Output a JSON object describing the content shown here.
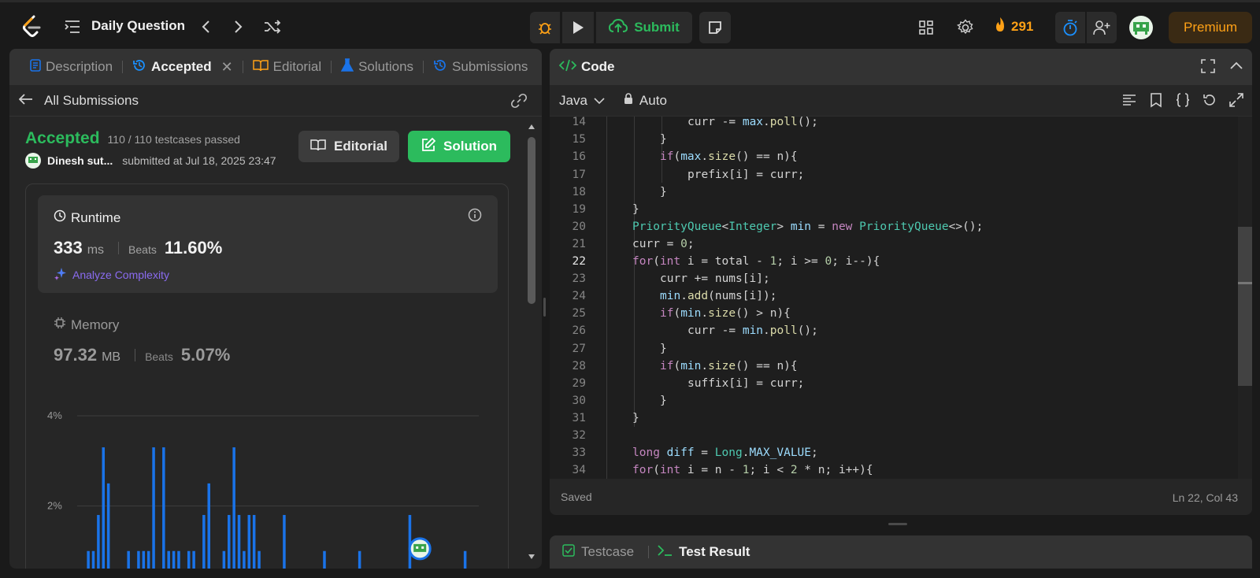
{
  "topbar": {
    "title": "Daily Question",
    "submit_label": "Submit",
    "streak": "291",
    "premium_label": "Premium"
  },
  "left_tabs": [
    {
      "label": "Description"
    },
    {
      "label": "Accepted"
    },
    {
      "label": "Editorial"
    },
    {
      "label": "Solutions"
    },
    {
      "label": "Submissions"
    }
  ],
  "all_submissions_label": "All Submissions",
  "submission": {
    "status": "Accepted",
    "testcases": "110 / 110 testcases passed",
    "user": "Dinesh sut...",
    "submitted_at": "submitted at Jul 18, 2025 23:47",
    "editorial_button": "Editorial",
    "solution_button": "Solution"
  },
  "runtime": {
    "label": "Runtime",
    "value": "333",
    "unit": "ms",
    "beats_label": "Beats",
    "beats_value": "11.60%",
    "analyze_label": "Analyze Complexity"
  },
  "memory": {
    "label": "Memory",
    "value": "97.32",
    "unit": "MB",
    "beats_label": "Beats",
    "beats_value": "5.07%"
  },
  "chart_data": {
    "type": "bar",
    "yticks": [
      "4%",
      "2%"
    ],
    "ylim": [
      0,
      4.5
    ],
    "grid": true,
    "values": [
      0.3,
      1,
      1,
      1.8,
      3.3,
      2.5,
      0.3,
      0.3,
      0.3,
      1,
      0.3,
      1,
      1,
      1,
      3.3,
      0.3,
      3.3,
      1,
      1,
      1,
      0.3,
      1,
      1,
      0.3,
      1.8,
      2.5,
      0.3,
      0.3,
      1,
      1.8,
      3.3,
      1.8,
      1,
      1.8,
      1.8,
      1,
      0.3,
      0.3,
      0.3,
      0.3,
      1.8,
      0.3,
      0.3,
      0.3,
      0.3,
      0.3,
      0.3,
      0.3,
      1,
      0.3,
      0.3,
      0.3,
      0.3,
      0.3,
      0.3,
      1,
      0.3,
      0.3,
      0.3,
      0.3,
      0.3,
      0.3,
      0.3,
      0.3,
      0.3,
      1.8,
      0.3,
      0.3,
      0.3,
      0.3,
      0.3,
      0.3,
      0.3,
      0.3,
      0.3,
      0.3,
      1,
      0.3,
      0.3
    ],
    "highlight_index": 67,
    "color": "#1a73e8"
  },
  "code_panel": {
    "title": "Code",
    "language": "Java",
    "mode": "Auto",
    "saved_label": "Saved",
    "cursor": "Ln 22, Col 43",
    "current_line": 22,
    "lines": [
      {
        "n": "14",
        "indent": 3,
        "segs": [
          [
            "t",
            "curr -= "
          ],
          [
            "vr",
            "max"
          ],
          [
            "t",
            "."
          ],
          [
            "fn",
            "poll"
          ],
          [
            "t",
            "();"
          ]
        ]
      },
      {
        "n": "15",
        "indent": 2,
        "segs": [
          [
            "t",
            "}"
          ]
        ]
      },
      {
        "n": "16",
        "indent": 2,
        "segs": [
          [
            "kw",
            "if"
          ],
          [
            "t",
            "("
          ],
          [
            "vr",
            "max"
          ],
          [
            "t",
            "."
          ],
          [
            "fn",
            "size"
          ],
          [
            "t",
            "() == n){"
          ]
        ]
      },
      {
        "n": "17",
        "indent": 3,
        "segs": [
          [
            "t",
            "prefix[i] = curr;"
          ]
        ]
      },
      {
        "n": "18",
        "indent": 2,
        "segs": [
          [
            "t",
            "}"
          ]
        ]
      },
      {
        "n": "19",
        "indent": 1,
        "segs": [
          [
            "t",
            "}"
          ]
        ]
      },
      {
        "n": "20",
        "indent": 1,
        "segs": [
          [
            "ty",
            "PriorityQueue"
          ],
          [
            "t",
            "<"
          ],
          [
            "ty",
            "Integer"
          ],
          [
            "t",
            "> "
          ],
          [
            "vr",
            "min"
          ],
          [
            "t",
            " = "
          ],
          [
            "kw",
            "new"
          ],
          [
            "t",
            " "
          ],
          [
            "ty",
            "PriorityQueue"
          ],
          [
            "t",
            "<>();"
          ]
        ]
      },
      {
        "n": "21",
        "indent": 1,
        "segs": [
          [
            "t",
            "curr = "
          ],
          [
            "nm",
            "0"
          ],
          [
            "t",
            ";"
          ]
        ]
      },
      {
        "n": "22",
        "indent": 1,
        "segs": [
          [
            "kw",
            "for"
          ],
          [
            "t",
            "("
          ],
          [
            "kw",
            "int"
          ],
          [
            "t",
            " i = total - "
          ],
          [
            "nm",
            "1"
          ],
          [
            "t",
            "; i >= "
          ],
          [
            "nm",
            "0"
          ],
          [
            "t",
            "; i--){"
          ]
        ]
      },
      {
        "n": "23",
        "indent": 2,
        "segs": [
          [
            "t",
            "curr += nums[i];"
          ]
        ]
      },
      {
        "n": "24",
        "indent": 2,
        "segs": [
          [
            "vr",
            "min"
          ],
          [
            "t",
            "."
          ],
          [
            "fn",
            "add"
          ],
          [
            "t",
            "(nums[i]);"
          ]
        ]
      },
      {
        "n": "25",
        "indent": 2,
        "segs": [
          [
            "kw",
            "if"
          ],
          [
            "t",
            "("
          ],
          [
            "vr",
            "min"
          ],
          [
            "t",
            "."
          ],
          [
            "fn",
            "size"
          ],
          [
            "t",
            "() > n){"
          ]
        ]
      },
      {
        "n": "26",
        "indent": 3,
        "segs": [
          [
            "t",
            "curr -= "
          ],
          [
            "vr",
            "min"
          ],
          [
            "t",
            "."
          ],
          [
            "fn",
            "poll"
          ],
          [
            "t",
            "();"
          ]
        ]
      },
      {
        "n": "27",
        "indent": 2,
        "segs": [
          [
            "t",
            "}"
          ]
        ]
      },
      {
        "n": "28",
        "indent": 2,
        "segs": [
          [
            "kw",
            "if"
          ],
          [
            "t",
            "("
          ],
          [
            "vr",
            "min"
          ],
          [
            "t",
            "."
          ],
          [
            "fn",
            "size"
          ],
          [
            "t",
            "() == n){"
          ]
        ]
      },
      {
        "n": "29",
        "indent": 3,
        "segs": [
          [
            "t",
            "suffix[i] = curr;"
          ]
        ]
      },
      {
        "n": "30",
        "indent": 2,
        "segs": [
          [
            "t",
            "}"
          ]
        ]
      },
      {
        "n": "31",
        "indent": 1,
        "segs": [
          [
            "t",
            "}"
          ]
        ]
      },
      {
        "n": "32",
        "indent": 0,
        "segs": []
      },
      {
        "n": "33",
        "indent": 1,
        "segs": [
          [
            "kw",
            "long"
          ],
          [
            "t",
            " "
          ],
          [
            "vr",
            "diff"
          ],
          [
            "t",
            " = "
          ],
          [
            "ty",
            "Long"
          ],
          [
            "t",
            "."
          ],
          [
            "vr",
            "MAX_VALUE"
          ],
          [
            "t",
            ";"
          ]
        ]
      },
      {
        "n": "34",
        "indent": 1,
        "segs": [
          [
            "kw",
            "for"
          ],
          [
            "t",
            "("
          ],
          [
            "kw",
            "int"
          ],
          [
            "t",
            " i = n - "
          ],
          [
            "nm",
            "1"
          ],
          [
            "t",
            "; i < "
          ],
          [
            "nm",
            "2"
          ],
          [
            "t",
            " * n; i++){"
          ]
        ]
      }
    ]
  },
  "bottom_tabs": [
    {
      "label": "Testcase"
    },
    {
      "label": "Test Result"
    }
  ]
}
